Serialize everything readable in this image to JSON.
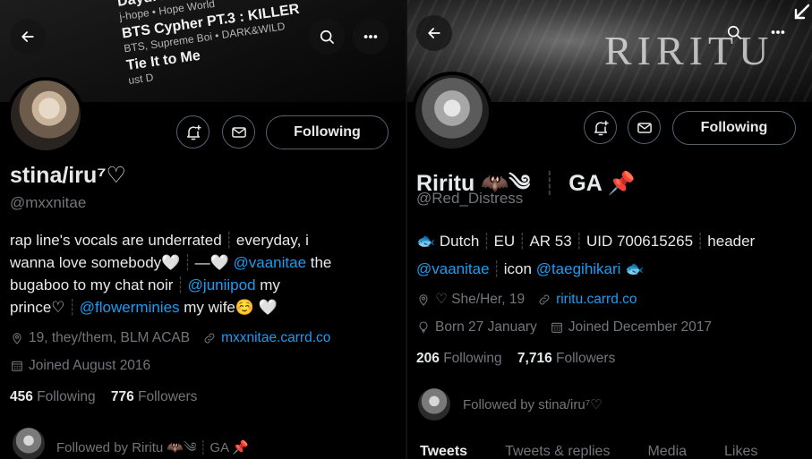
{
  "left": {
    "banner": {
      "playlist": [
        {
          "song": "Daydream (",
          "artist": "j-hope • Hope World"
        },
        {
          "song": "BTS Cypher PT.3 : KILLER",
          "artist": "BTS, Supreme Boi • DARK&WILD"
        },
        {
          "song": "Tie It to Me",
          "artist": "ust D"
        }
      ]
    },
    "profile": {
      "name": "stina/iru⁷♡",
      "handle": "@mxxnitae",
      "follow_label": "Following",
      "bio": {
        "l1a": "rap line's vocals are underrated",
        "l1b": "everyday, i",
        "l2a": "wanna love somebody🤍",
        "l2b": "—🤍",
        "l2_mention": "@vaanitae",
        "l2c": " the",
        "l3a": "bugaboo to my chat noir",
        "l3_mention": "@juniipod",
        "l3c": " my",
        "l4a": "prince♡",
        "l4_mention": "@flowerminies",
        "l4c": " my wife☺️ 🤍"
      },
      "location": "19, they/them, BLM ACAB",
      "website": "mxxnitae.carrd.co",
      "joined": "Joined August 2016",
      "following_count": "456",
      "following_label": "Following",
      "followers_count": "776",
      "followers_label": "Followers",
      "followed_by": "Followed by Riritu 🦇༄",
      "followed_by_extra": "GA 📌"
    }
  },
  "right": {
    "banner": {
      "text": "RIRITU"
    },
    "profile": {
      "name": "Riritu 🦇༄",
      "name_extra": "GA 📌",
      "handle": "@Red_Distress",
      "follow_label": "Following",
      "bio": {
        "l1a": "🐟 Dutch",
        "l1b": "EU",
        "l1c": "AR 53",
        "l1d": "UID 700615265",
        "l1e": "header",
        "l2_mention1": "@vaanitae",
        "l2b": "icon ",
        "l2_mention2": "@taegihikari",
        "l2c": " 🐟"
      },
      "location": "♡ She/Her, 19",
      "website": "riritu.carrd.co",
      "born": "Born 27 January",
      "joined": "Joined December 2017",
      "following_count": "206",
      "following_label": "Following",
      "followers_count": "7,716",
      "followers_label": "Followers",
      "followed_by": "Followed by stina/iru⁷♡",
      "tabs": [
        "Tweets",
        "Tweets & replies",
        "Media",
        "Likes"
      ]
    }
  },
  "colors": {
    "accent": "#1d9bf0",
    "muted": "#71767b",
    "text": "#e7e9ea",
    "border": "#536471"
  }
}
